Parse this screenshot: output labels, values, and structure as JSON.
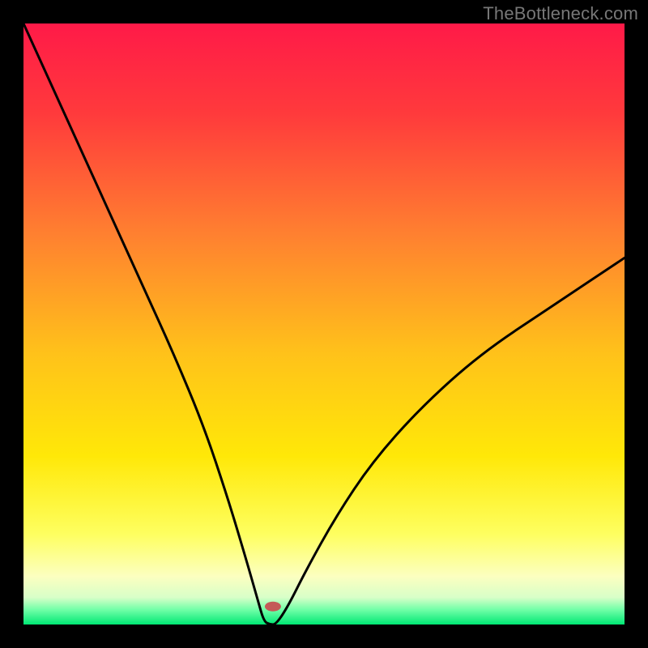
{
  "watermark": "TheBottleneck.com",
  "chart_data": {
    "type": "line",
    "title": "",
    "xlabel": "",
    "ylabel": "",
    "xlim": [
      0,
      100
    ],
    "ylim": [
      0,
      100
    ],
    "background_gradient": {
      "stops": [
        {
          "offset": 0.0,
          "color": "#ff1a48"
        },
        {
          "offset": 0.15,
          "color": "#ff3a3c"
        },
        {
          "offset": 0.35,
          "color": "#ff8030"
        },
        {
          "offset": 0.55,
          "color": "#ffc21a"
        },
        {
          "offset": 0.72,
          "color": "#ffe808"
        },
        {
          "offset": 0.85,
          "color": "#feff60"
        },
        {
          "offset": 0.92,
          "color": "#fcffc0"
        },
        {
          "offset": 0.955,
          "color": "#d8ffc8"
        },
        {
          "offset": 0.975,
          "color": "#72ffa8"
        },
        {
          "offset": 1.0,
          "color": "#00e874"
        }
      ]
    },
    "series": [
      {
        "name": "bottleneck-curve",
        "x": [
          0,
          5,
          10,
          15,
          20,
          25,
          30,
          34,
          37,
          39,
          40,
          41,
          42,
          44,
          47,
          52,
          58,
          66,
          76,
          88,
          100
        ],
        "y": [
          100,
          89,
          78,
          67,
          56,
          45,
          33,
          21,
          11,
          4,
          0.5,
          0,
          0,
          3,
          9,
          18,
          27,
          36,
          45,
          53,
          61
        ]
      }
    ],
    "marker": {
      "name": "optimal-point",
      "x": 41.5,
      "y": 3,
      "color": "#c45a58",
      "rx": 10,
      "ry": 6
    }
  }
}
